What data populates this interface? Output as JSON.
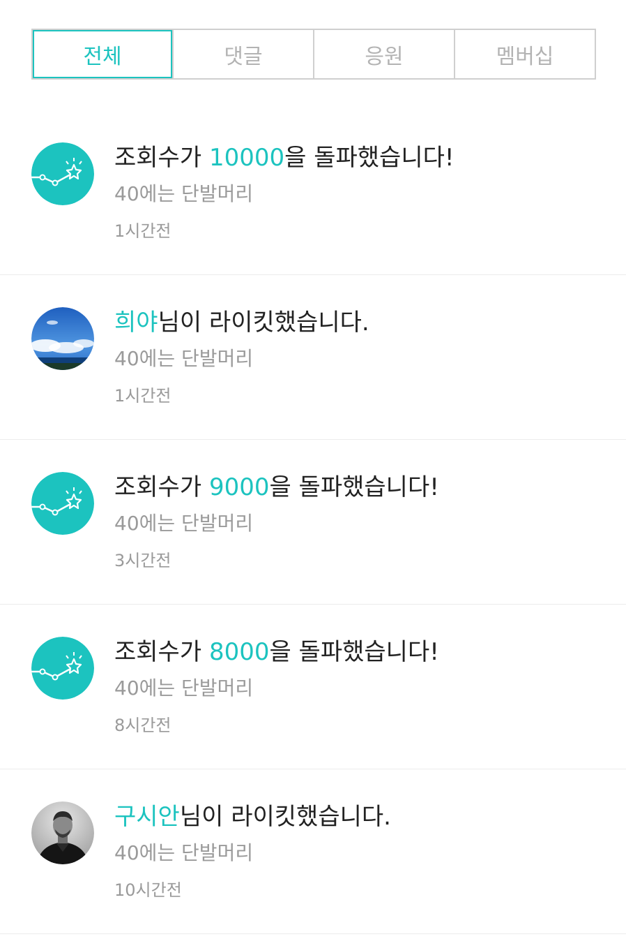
{
  "tabs": [
    {
      "label": "전체",
      "active": true
    },
    {
      "label": "댓글",
      "active": false
    },
    {
      "label": "응원",
      "active": false
    },
    {
      "label": "멤버십",
      "active": false
    }
  ],
  "feed": [
    {
      "type": "milestone",
      "title_pre": "조회수가 ",
      "title_highlight": "10000",
      "title_post": "을 돌파했습니다!",
      "subtitle": "40에는 단발머리",
      "time": "1시간전",
      "icon": "chart-star-icon"
    },
    {
      "type": "like",
      "title_pre": "",
      "title_highlight": "희야",
      "title_post": "님이 라이킷했습니다.",
      "subtitle": "40에는 단발머리",
      "time": "1시간전",
      "icon": "sky-photo-avatar"
    },
    {
      "type": "milestone",
      "title_pre": "조회수가 ",
      "title_highlight": "9000",
      "title_post": "을 돌파했습니다!",
      "subtitle": "40에는 단발머리",
      "time": "3시간전",
      "icon": "chart-star-icon"
    },
    {
      "type": "milestone",
      "title_pre": "조회수가 ",
      "title_highlight": "8000",
      "title_post": "을 돌파했습니다!",
      "subtitle": "40에는 단발머리",
      "time": "8시간전",
      "icon": "chart-star-icon"
    },
    {
      "type": "like",
      "title_pre": "",
      "title_highlight": "구시안",
      "title_post": "님이 라이킷했습니다.",
      "subtitle": "40에는 단발머리",
      "time": "10시간전",
      "icon": "person-photo-avatar"
    }
  ],
  "colors": {
    "accent": "#1cc3bf",
    "muted": "#9a9a9a",
    "border": "#cfcfcf"
  }
}
